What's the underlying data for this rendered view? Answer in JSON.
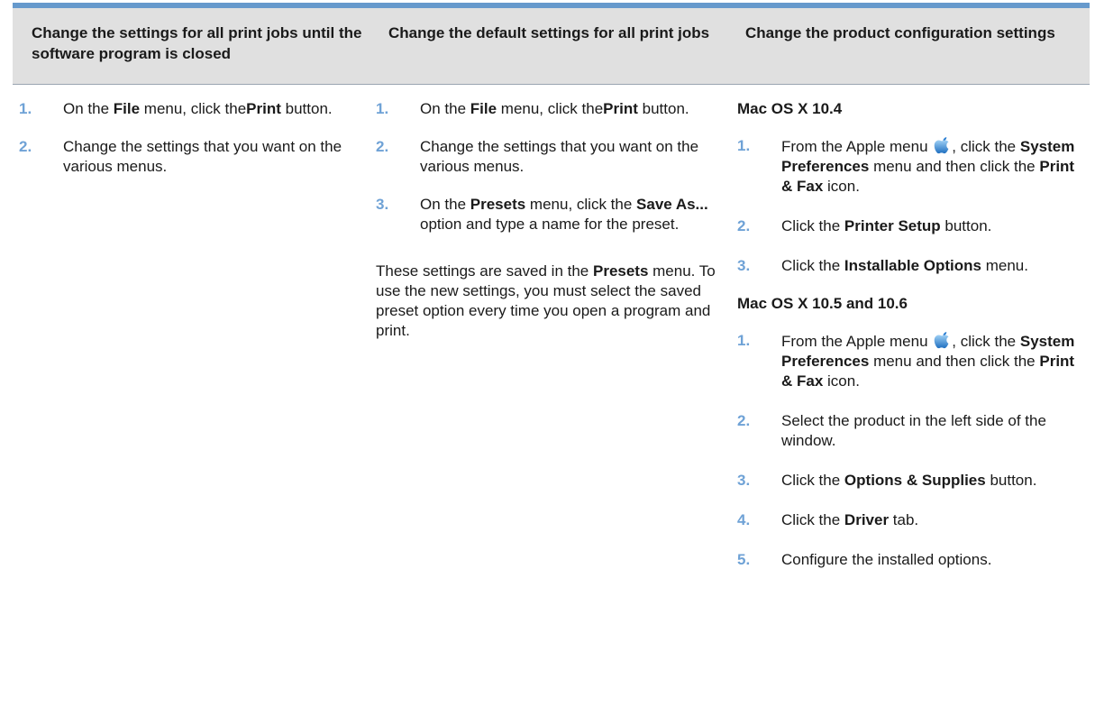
{
  "headers": [
    "Change the settings for all print jobs until the software program is closed",
    "Change the default settings for all print jobs",
    "Change the product configuration settings"
  ],
  "col1": {
    "steps": [
      {
        "num": "1.",
        "parts": [
          {
            "t": "On the "
          },
          {
            "t": "File",
            "b": true
          },
          {
            "t": " menu, click the"
          },
          {
            "t": "Print",
            "b": true
          },
          {
            "t": " button."
          }
        ]
      },
      {
        "num": "2.",
        "parts": [
          {
            "t": "Change the settings that you want on the various menus."
          }
        ]
      }
    ]
  },
  "col2": {
    "steps": [
      {
        "num": "1.",
        "parts": [
          {
            "t": "On the "
          },
          {
            "t": "File",
            "b": true
          },
          {
            "t": " menu, click the"
          },
          {
            "t": "Print",
            "b": true
          },
          {
            "t": " button."
          }
        ]
      },
      {
        "num": "2.",
        "parts": [
          {
            "t": "Change the settings that you want on the various menus."
          }
        ]
      },
      {
        "num": "3.",
        "parts": [
          {
            "t": "On the "
          },
          {
            "t": "Presets",
            "b": true
          },
          {
            "t": " menu, click the "
          },
          {
            "t": "Save As...",
            "b": true
          },
          {
            "t": " option and type a name for the preset."
          }
        ]
      }
    ],
    "note": [
      {
        "t": "These settings are saved in the "
      },
      {
        "t": "Presets",
        "b": true
      },
      {
        "t": " menu. To use the new settings, you must select the saved preset option every time you open a program and print."
      }
    ]
  },
  "col3": {
    "sections": [
      {
        "title": "Mac OS X 10.4",
        "steps": [
          {
            "num": "1.",
            "parts": [
              {
                "t": "From the Apple menu "
              },
              {
                "icon": "apple-icon"
              },
              {
                "t": ", click the "
              },
              {
                "t": "System Preferences",
                "b": true
              },
              {
                "t": " menu and then click the "
              },
              {
                "t": "Print & Fax",
                "b": true
              },
              {
                "t": " icon."
              }
            ]
          },
          {
            "num": "2.",
            "parts": [
              {
                "t": "Click the "
              },
              {
                "t": "Printer Setup",
                "b": true
              },
              {
                "t": " button."
              }
            ]
          },
          {
            "num": "3.",
            "parts": [
              {
                "t": "Click the "
              },
              {
                "t": "Installable Options",
                "b": true
              },
              {
                "t": " menu."
              }
            ]
          }
        ]
      },
      {
        "title": "Mac OS X 10.5 and 10.6",
        "steps": [
          {
            "num": "1.",
            "parts": [
              {
                "t": "From the Apple menu "
              },
              {
                "icon": "apple-icon"
              },
              {
                "t": ", click the "
              },
              {
                "t": "System Preferences",
                "b": true
              },
              {
                "t": " menu and then click the "
              },
              {
                "t": "Print & Fax",
                "b": true
              },
              {
                "t": " icon."
              }
            ]
          },
          {
            "num": "2.",
            "parts": [
              {
                "t": "Select the product in the left side of the window."
              }
            ]
          },
          {
            "num": "3.",
            "parts": [
              {
                "t": "Click the "
              },
              {
                "t": "Options & Supplies",
                "b": true
              },
              {
                "t": " button."
              }
            ]
          },
          {
            "num": "4.",
            "parts": [
              {
                "t": "Click the "
              },
              {
                "t": "Driver",
                "b": true
              },
              {
                "t": " tab."
              }
            ]
          },
          {
            "num": "5.",
            "parts": [
              {
                "t": "Configure the installed options."
              }
            ]
          }
        ]
      }
    ]
  },
  "colors": {
    "accent": "#6699cc",
    "number": "#6fa2d6",
    "header_bg": "#e0e0e0"
  }
}
